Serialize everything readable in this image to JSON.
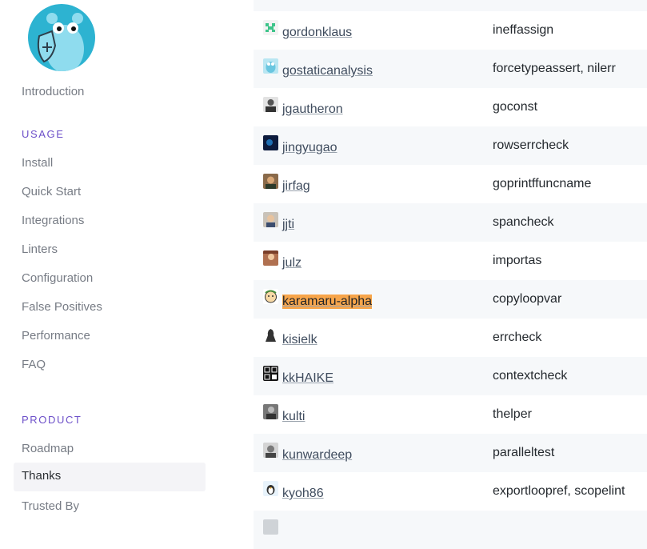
{
  "sidebar": {
    "introduction": "Introduction",
    "usage_title": "USAGE",
    "usage_items": [
      "Install",
      "Quick Start",
      "Integrations",
      "Linters",
      "Configuration",
      "False Positives",
      "Performance",
      "FAQ"
    ],
    "product_title": "PRODUCT",
    "product_items": [
      "Roadmap",
      "Thanks",
      "Trusted By"
    ],
    "active_item": "Thanks"
  },
  "table": {
    "rows": [
      {
        "user": "",
        "linters": "",
        "avatar_icon": "partial-avatar"
      },
      {
        "user": "gordonklaus",
        "linters": "ineffassign",
        "avatar_icon": "green-pixel-avatar"
      },
      {
        "user": "gostaticanalysis",
        "linters": "forcetypeassert, nilerr",
        "avatar_icon": "gopher-avatar"
      },
      {
        "user": "jgautheron",
        "linters": "goconst",
        "avatar_icon": "person-avatar"
      },
      {
        "user": "jingyugao",
        "linters": "rowserrcheck",
        "avatar_icon": "dark-blue-avatar"
      },
      {
        "user": "jirfag",
        "linters": "goprintffuncname",
        "avatar_icon": "person-avatar"
      },
      {
        "user": "jjti",
        "linters": "spancheck",
        "avatar_icon": "person-avatar"
      },
      {
        "user": "julz",
        "linters": "importas",
        "avatar_icon": "photo-avatar"
      },
      {
        "user": "karamaru-alpha",
        "linters": "copyloopvar",
        "avatar_icon": "cartoon-avatar",
        "highlighted": true
      },
      {
        "user": "kisielk",
        "linters": "errcheck",
        "avatar_icon": "silhouette-avatar"
      },
      {
        "user": "kkHAIKE",
        "linters": "contextcheck",
        "avatar_icon": "pattern-avatar"
      },
      {
        "user": "kulti",
        "linters": "thelper",
        "avatar_icon": "photo-avatar"
      },
      {
        "user": "kunwardeep",
        "linters": "paralleltest",
        "avatar_icon": "person-avatar"
      },
      {
        "user": "kyoh86",
        "linters": "exportloopref, scopelint",
        "avatar_icon": "penguin-avatar"
      },
      {
        "user": "",
        "linters": "",
        "avatar_icon": "partial-avatar"
      }
    ]
  },
  "colors": {
    "accent": "#6d50c9",
    "highlight": "#f7a54a",
    "row_alt": "#f6f8fa"
  }
}
